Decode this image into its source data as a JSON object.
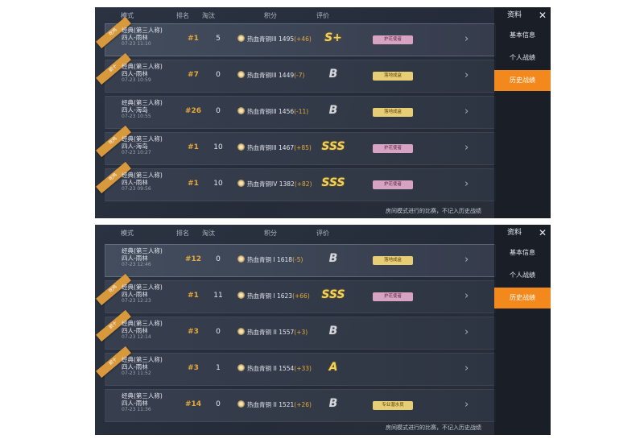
{
  "headers": {
    "mode": "模式",
    "rank": "排名",
    "kills": "淘汰",
    "score": "积分",
    "grade": "评价"
  },
  "panels": [
    {
      "side": {
        "title": "资料",
        "items": [
          "基本信息",
          "个人战绩",
          "历史战绩"
        ]
      },
      "note": "房间模式进行的比赛，不记入历史战绩",
      "rows": [
        {
          "mode": "经典(第三人称)",
          "map": "四人-雨林",
          "time": "07-23 11:10",
          "rank": "#1",
          "kills": "5",
          "score_base": "热血青铜III 1495",
          "delta": "(+46)",
          "grade": "S+",
          "tag": "护花使者",
          "ribbon": "吃鸡"
        },
        {
          "mode": "经典(第三人称)",
          "map": "四人-雨林",
          "time": "07-23 10:59",
          "rank": "#7",
          "kills": "0",
          "score_base": "热血青铜III 1449",
          "delta": "(-7)",
          "grade": "B",
          "tag": "落地成盒",
          "ribbon": "前十"
        },
        {
          "mode": "经典(第三人称)",
          "map": "四人-海岛",
          "time": "07-23 10:55",
          "rank": "#26",
          "kills": "0",
          "score_base": "热血青铜III 1456",
          "delta": "(-11)",
          "grade": "B",
          "tag": "落地成盒",
          "ribbon": ""
        },
        {
          "mode": "经典(第三人称)",
          "map": "四人-海岛",
          "time": "07-23 10:27",
          "rank": "#1",
          "kills": "10",
          "score_base": "热血青铜III 1467",
          "delta": "(+85)",
          "grade": "SSS",
          "tag": "护花使者",
          "ribbon": "吃鸡"
        },
        {
          "mode": "经典(第三人称)",
          "map": "四人-雨林",
          "time": "07-23 09:56",
          "rank": "#1",
          "kills": "10",
          "score_base": "热血青铜IV 1382",
          "delta": "(+82)",
          "grade": "SSS",
          "tag": "护花使者",
          "ribbon": "吃鸡"
        }
      ]
    },
    {
      "side": {
        "title": "资料",
        "items": [
          "基本信息",
          "个人战绩",
          "历史战绩"
        ]
      },
      "note": "房间模式进行的比赛，不记入历史战绩",
      "rows": [
        {
          "mode": "经典(第三人称)",
          "map": "四人-雨林",
          "time": "07-23 12:46",
          "rank": "#12",
          "kills": "0",
          "score_base": "热血青铜 I 1618",
          "delta": "(-5)",
          "grade": "B",
          "tag": "落地成盒",
          "ribbon": ""
        },
        {
          "mode": "经典(第三人称)",
          "map": "四人-雨林",
          "time": "07-23 12:23",
          "rank": "#1",
          "kills": "11",
          "score_base": "热血青铜 I 1623",
          "delta": "(+66)",
          "grade": "SSS",
          "tag": "护花使者",
          "ribbon": "吃鸡"
        },
        {
          "mode": "经典(第三人称)",
          "map": "四人-雨林",
          "time": "07-23 12:14",
          "rank": "#3",
          "kills": "0",
          "score_base": "热血青铜 II 1557",
          "delta": "(+3)",
          "grade": "B",
          "tag": "",
          "ribbon": "前十"
        },
        {
          "mode": "经典(第三人称)",
          "map": "四人-雨林",
          "time": "07-23 11:52",
          "rank": "#3",
          "kills": "1",
          "score_base": "热血青铜 II 1554",
          "delta": "(+33)",
          "grade": "A",
          "tag": "",
          "ribbon": "前十"
        },
        {
          "mode": "经典(第三人称)",
          "map": "四人-雨林",
          "time": "07-23 11:36",
          "rank": "#14",
          "kills": "0",
          "score_base": "热血青铜 II 1521",
          "delta": "(+26)",
          "grade": "B",
          "tag": "专业潜水员",
          "ribbon": ""
        }
      ]
    }
  ]
}
